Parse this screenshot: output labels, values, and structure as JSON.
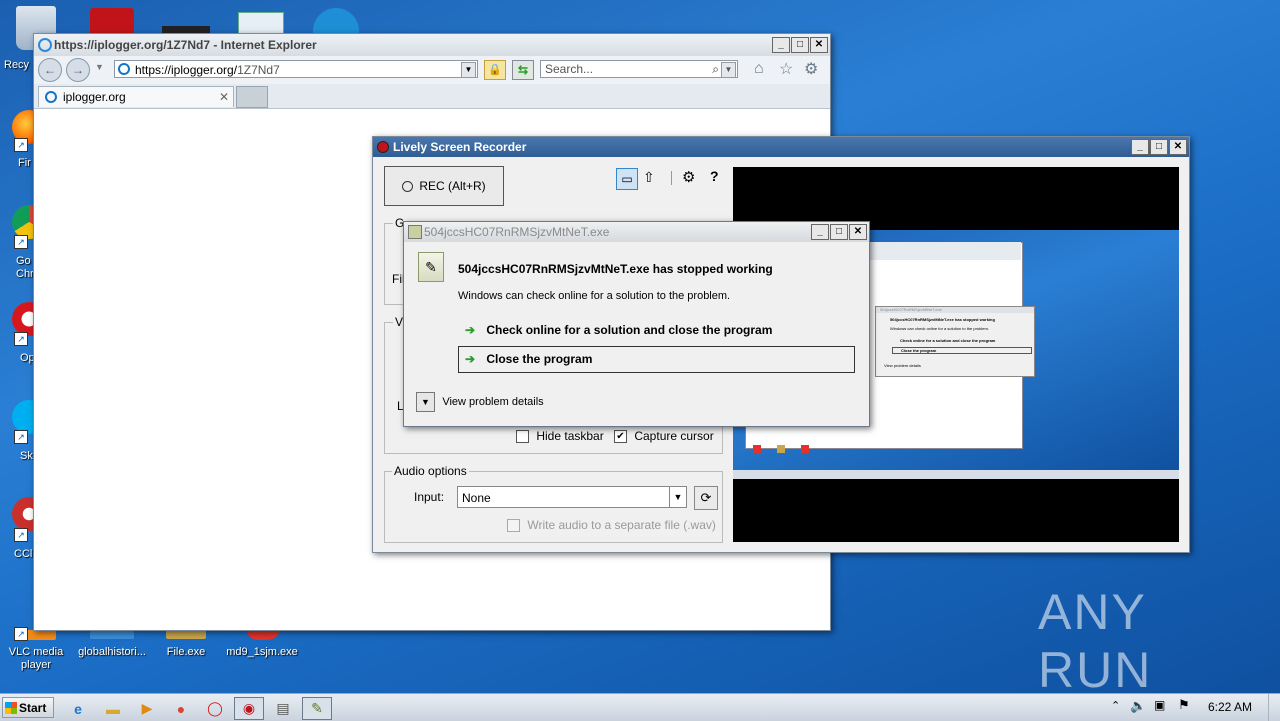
{
  "desktop": {
    "icons": [
      {
        "label": "Recy"
      },
      {
        "label": "Fir"
      },
      {
        "label": "Go\nChr"
      },
      {
        "label": "Op"
      },
      {
        "label": "Sk"
      },
      {
        "label": "CCl"
      },
      {
        "label": "VLC media\nplayer"
      },
      {
        "label": "globalhistori..."
      },
      {
        "label": "File.exe"
      },
      {
        "label": "md9_1sjm.exe"
      }
    ],
    "watermark": "ANY RUN"
  },
  "browser": {
    "title": "https://iplogger.org/1Z7Nd7 - Internet Explorer",
    "address_prefix": "https://iplogger.org/",
    "address_path": "1Z7Nd7",
    "search_placeholder": "Search...",
    "tab_label": "iplogger.org"
  },
  "recorder": {
    "title": "Lively Screen Recorder",
    "rec_label": "REC (Alt+R)",
    "group_general": "G",
    "file_label": "Fil",
    "group_video": "Vi",
    "l_label": "L",
    "hide_taskbar": "Hide taskbar",
    "hide_taskbar_checked": false,
    "capture_cursor": "Capture cursor",
    "capture_cursor_checked": true,
    "audio_group": "Audio options",
    "input_label": "Input:",
    "input_value": "None",
    "write_audio": "Write audio to a separate file (.wav)",
    "write_audio_checked": false
  },
  "error_dialog": {
    "title": "504jccsHC07RnRMSjzvMtNeT.exe",
    "heading": "504jccsHC07RnRMSjzvMtNeT.exe has stopped working",
    "message": "Windows can check online for a solution to the problem.",
    "option_check_online": "Check online for a solution and close the program",
    "option_close": "Close the program",
    "details": "View problem details"
  },
  "preview_dialog": {
    "title": "504jccsHC07RnRMSjzvMtNeT.exe",
    "heading": "504jccsHC07RnRMSjzvMtNeT.exe has stopped working",
    "message": "Windows can check online for a solution to the problem.",
    "option_check_online": "Check online for a solution and close the program",
    "option_close": "Close the program",
    "details": "View problem details"
  },
  "taskbar": {
    "start": "Start",
    "clock": "6:22 AM"
  },
  "colors": {
    "desktop": "#1a6cc4",
    "title_blue": "#3c6fa8",
    "accent_green": "#2a9d2a"
  }
}
